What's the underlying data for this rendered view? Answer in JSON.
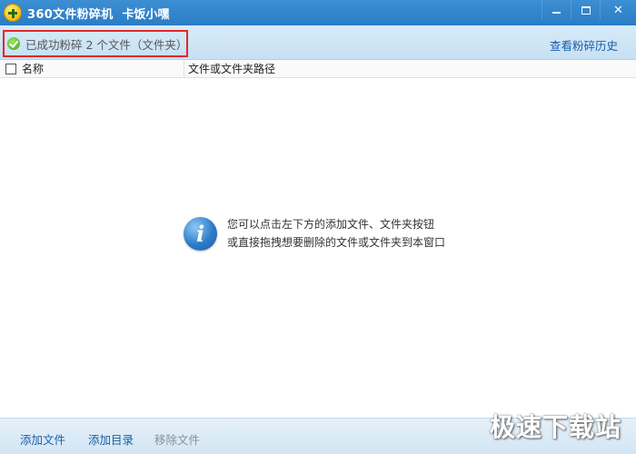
{
  "window": {
    "title": "360文件粉碎机",
    "subtitle": "卡饭小嘿",
    "minimize_label": "",
    "maximize_label": "",
    "close_label": "✕"
  },
  "status": {
    "message": "已成功粉碎 2 个文件（文件夹）",
    "history_link": "查看粉碎历史"
  },
  "table": {
    "columns": [
      "名称",
      "文件或文件夹路径"
    ]
  },
  "empty_hint": {
    "line1": "您可以点击左下方的添加文件、文件夹按钮",
    "line2": "或直接拖拽想要删除的文件或文件夹到本窗口",
    "icon_glyph": "i"
  },
  "bottom": {
    "add_file": "添加文件",
    "add_dir": "添加目录",
    "remove_file": "移除文件"
  },
  "watermark": "极速下载站",
  "colors": {
    "titlebar": "#2a7cc5",
    "link": "#1a5fa8",
    "highlight_border": "#e02828"
  }
}
